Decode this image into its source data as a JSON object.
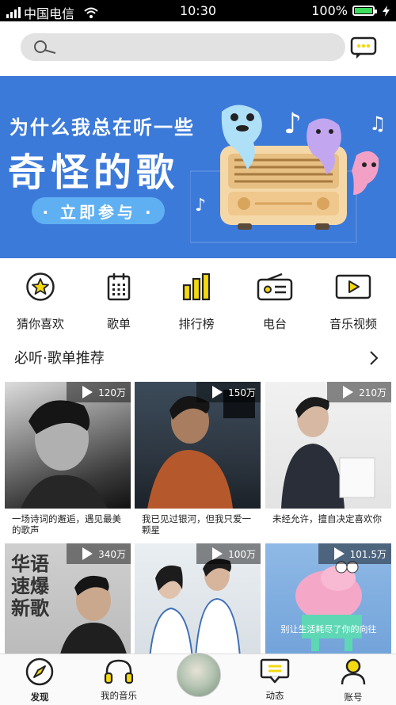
{
  "status": {
    "carrier": "中国电信",
    "time": "10:30",
    "battery": "100%",
    "battery_level": 1.0
  },
  "search": {
    "placeholder": ""
  },
  "banner": {
    "line1": "为什么我总在听一些",
    "line2": "奇怪的歌",
    "cta": "· 立即参与 ·"
  },
  "categories": [
    {
      "label": "猜你喜欢",
      "icon": "star-icon"
    },
    {
      "label": "歌单",
      "icon": "calendar-grid-icon"
    },
    {
      "label": "排行榜",
      "icon": "bar-chart-icon"
    },
    {
      "label": "电台",
      "icon": "radio-icon"
    },
    {
      "label": "音乐视频",
      "icon": "video-play-icon"
    }
  ],
  "section": {
    "title": "必听·歌单推荐"
  },
  "cards": [
    {
      "count": "120万",
      "caption": "一场诗词的邂逅，遇见最美的歌声"
    },
    {
      "count": "150万",
      "caption": "我已见过银河，但我只爱一颗星"
    },
    {
      "count": "210万",
      "caption": "未经允许，擅自决定喜欢你"
    },
    {
      "count": "340万",
      "caption": "",
      "overlay": "华语 速爆 新歌"
    },
    {
      "count": "100万",
      "caption": ""
    },
    {
      "count": "101.5万",
      "caption": "",
      "overlay": "别让生活耗尽了你的向往"
    }
  ],
  "tabs": [
    {
      "label": "发现",
      "icon": "compass-icon",
      "active": true
    },
    {
      "label": "我的音乐",
      "icon": "headphones-icon",
      "active": false
    },
    {
      "label": "",
      "icon": "now-playing-disc",
      "active": false
    },
    {
      "label": "动态",
      "icon": "chat-bubble-icon",
      "active": false
    },
    {
      "label": "账号",
      "icon": "person-icon",
      "active": false
    }
  ],
  "colors": {
    "accent": "#f5d90f",
    "banner_bg": "#3c7ad9",
    "search_bg": "#e2e2e2"
  }
}
